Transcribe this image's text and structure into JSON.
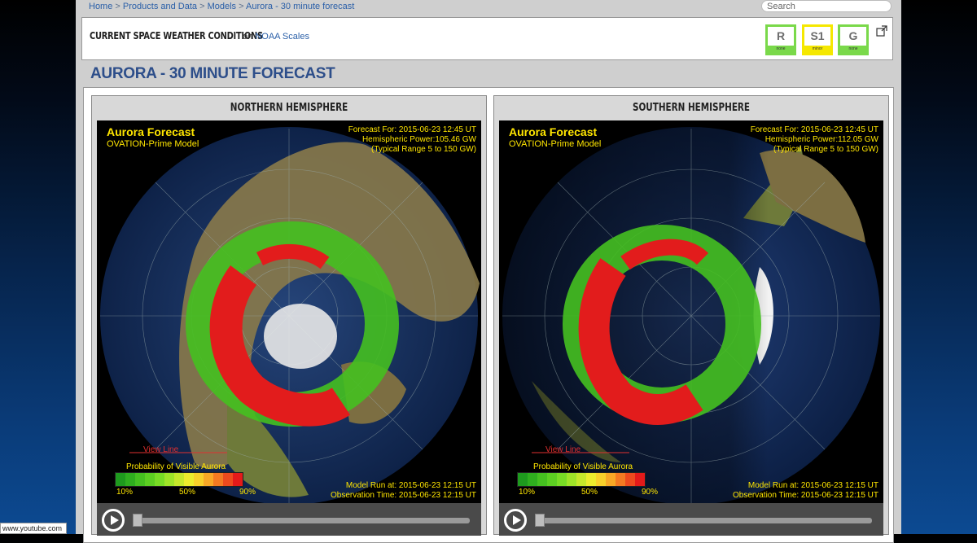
{
  "breadcrumb": {
    "home": "Home",
    "products": "Products and Data",
    "models": "Models",
    "current": "Aurora - 30 minute forecast",
    "sep": ">"
  },
  "search": {
    "placeholder": "Search"
  },
  "conditions": {
    "title": "CURRENT SPACE WEATHER CONDITIONS",
    "on": "on",
    "link": "NOAA Scales"
  },
  "scales": [
    {
      "letter": "R",
      "level": "none",
      "color": "#7ad94a"
    },
    {
      "letter": "S1",
      "level": "minor",
      "color": "#f5e800"
    },
    {
      "letter": "G",
      "level": "none",
      "color": "#7ad94a"
    }
  ],
  "page_title": "AURORA - 30 MINUTE FORECAST",
  "north": {
    "heading": "NORTHERN HEMISPHERE",
    "title": "Aurora Forecast",
    "model": "OVATION-Prime Model",
    "forecast_for": "Forecast For: 2015-06-23 12:45 UT",
    "power": "Hemispheric Power:105.46 GW",
    "range": "(Typical Range 5 to 150 GW)",
    "view_line": "View Line",
    "prob_title": "Probability of Visible Aurora",
    "tick_10": "10%",
    "tick_50": "50%",
    "tick_90": "90%",
    "model_run": "Model Run at: 2015-06-23 12:15 UT",
    "obs_time": "Observation Time: 2015-06-23 12:15 UT"
  },
  "south": {
    "heading": "SOUTHERN HEMISPHERE",
    "title": "Aurora Forecast",
    "model": "OVATION-Prime Model",
    "forecast_for": "Forecast For: 2015-06-23 12:45 UT",
    "power": "Hemispheric Power:112.05 GW",
    "range": "(Typical Range 5 to 150 GW)",
    "view_line": "View Line",
    "prob_title": "Probability of Visible Aurora",
    "tick_10": "10%",
    "tick_50": "50%",
    "tick_90": "90%",
    "model_run": "Model Run at: 2015-06-23 12:15 UT",
    "obs_time": "Observation Time: 2015-06-23 12:15 UT"
  },
  "legend_colors": [
    "#1e9a1e",
    "#2fae1f",
    "#45c020",
    "#5ccf22",
    "#78dc25",
    "#9fe428",
    "#c6e82b",
    "#ecec2d",
    "#f8d02a",
    "#f8a826",
    "#f47a22",
    "#ee4a1e",
    "#e41a1a"
  ],
  "watermark": "www.youtube.com"
}
